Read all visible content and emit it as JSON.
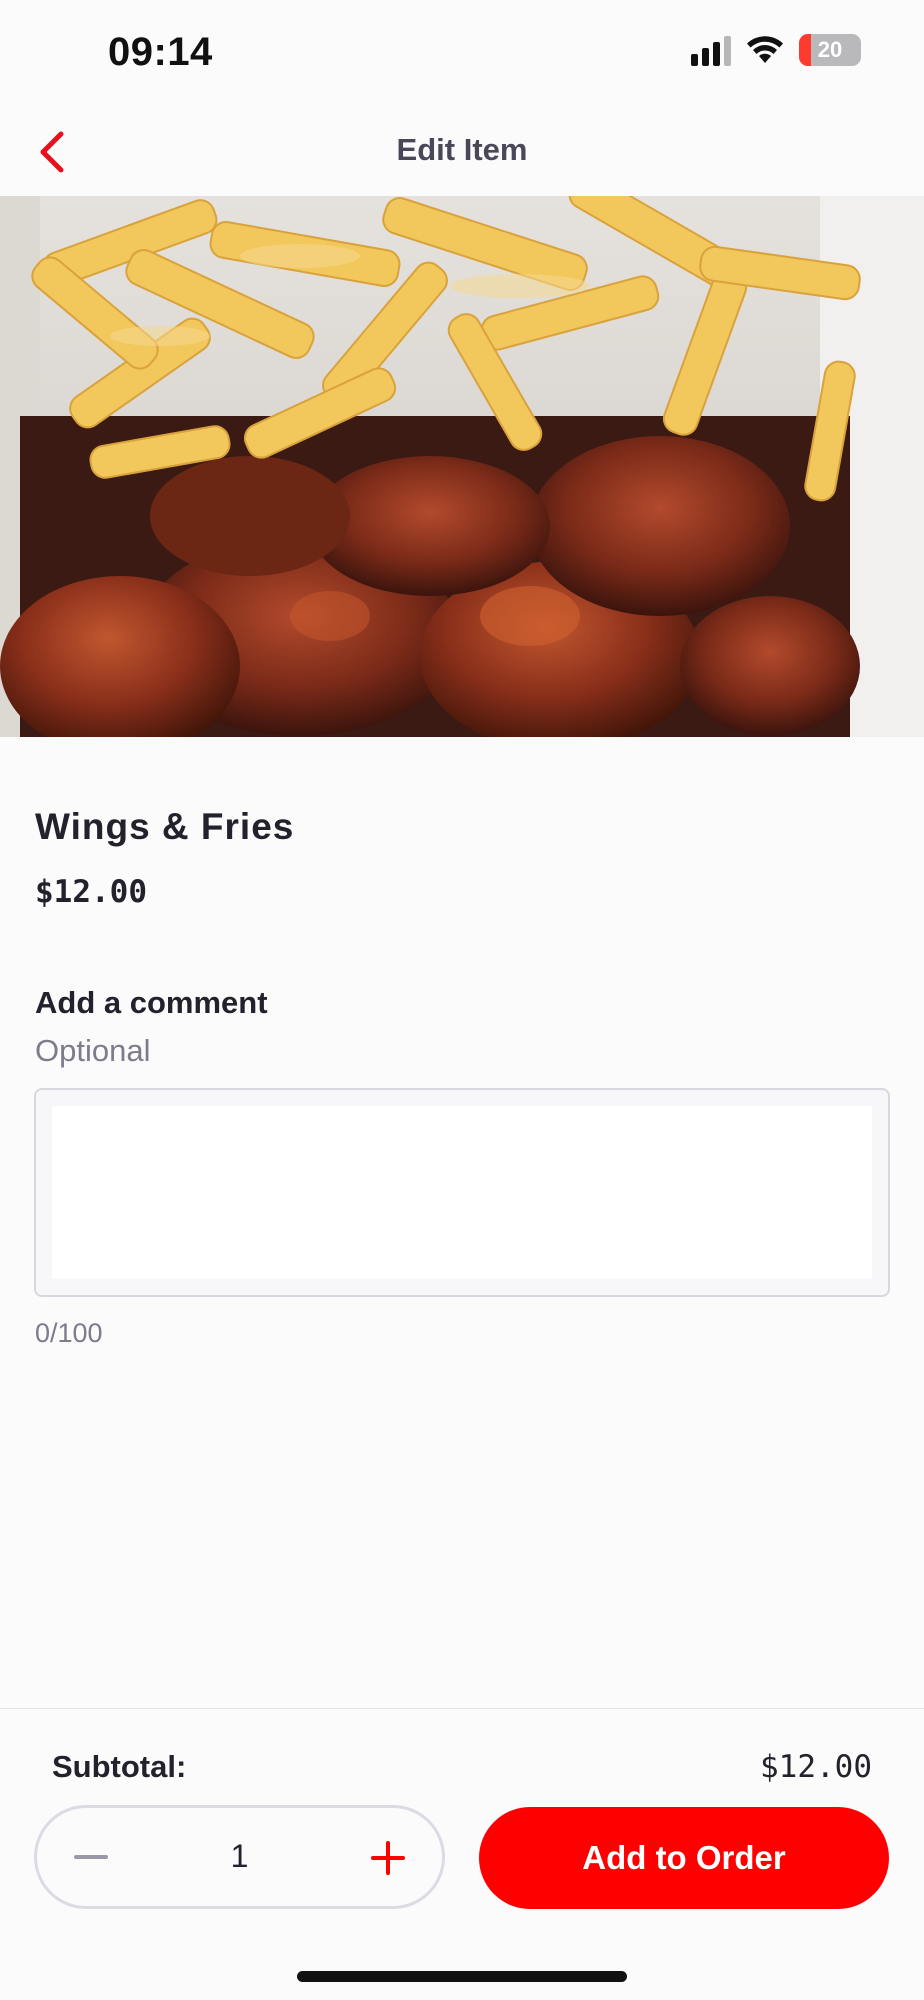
{
  "status_bar": {
    "time": "09:14",
    "battery_level": "20",
    "icons": [
      "cellular-signal-icon",
      "wifi-icon",
      "battery-charging-icon"
    ]
  },
  "header": {
    "title": "Edit Item",
    "back_icon": "chevron-left-icon"
  },
  "item": {
    "name": "Wings & Fries",
    "price": "$12.00",
    "image_description": "wings-and-fries-photo"
  },
  "comment": {
    "title": "Add a comment",
    "subtitle": "Optional",
    "value": "",
    "char_count": "0/100"
  },
  "footer": {
    "subtotal_label": "Subtotal:",
    "subtotal_value": "$12.00",
    "quantity": "1",
    "add_button_label": "Add to Order"
  },
  "colors": {
    "accent": "#ff0000",
    "text_primary": "#23222c",
    "text_secondary": "#7d7b8c",
    "background": "#fbfbfc"
  }
}
